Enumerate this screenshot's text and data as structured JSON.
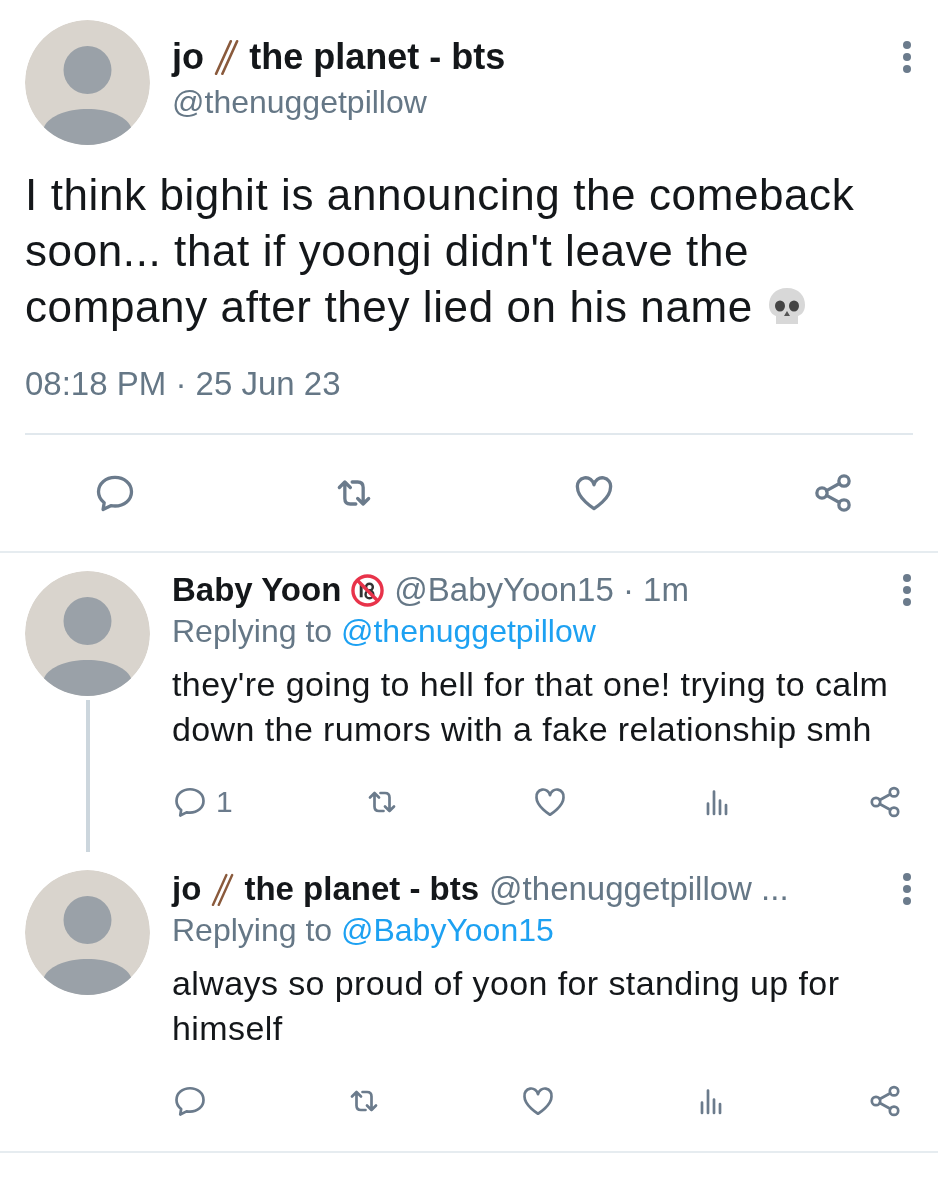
{
  "main_tweet": {
    "name": [
      {
        "kind": "text",
        "text": "jo"
      },
      {
        "kind": "chopsticks"
      },
      {
        "kind": "text",
        "text": "the planet - bts"
      }
    ],
    "handle": "@thenuggetpillow",
    "text": "I think bighit is announcing the comeback soon... that if yoongi didn't leave the company after they lied on his name",
    "trailing_icon": {
      "kind": "skull"
    },
    "timestamp": "08:18 PM · 25 Jun 23",
    "actions": [
      {
        "kind": "reply"
      },
      {
        "kind": "retweet"
      },
      {
        "kind": "like"
      },
      {
        "kind": "share"
      }
    ]
  },
  "replies": [
    {
      "name": [
        {
          "kind": "text",
          "text": "Baby Yoon"
        },
        {
          "kind": "adult"
        }
      ],
      "handle": "@BabyYoon15 · 1m",
      "replying_label": "Replying to",
      "replying_to": "@thenuggetpillow",
      "text": "they're going to hell for that one! trying to calm down the rumors with a fake relationship smh",
      "thread_line": true,
      "actions": [
        {
          "kind": "reply",
          "count": "1"
        },
        {
          "kind": "retweet"
        },
        {
          "kind": "like"
        },
        {
          "kind": "views"
        },
        {
          "kind": "share"
        }
      ]
    },
    {
      "name": [
        {
          "kind": "text",
          "text": "jo"
        },
        {
          "kind": "chopsticks"
        },
        {
          "kind": "text",
          "text": "the planet - bts"
        }
      ],
      "handle": "@thenuggetpillow ...",
      "replying_label": "Replying to",
      "replying_to": "@BabyYoon15",
      "text": "always so proud of yoon for standing up for himself",
      "thread_line": false,
      "actions": [
        {
          "kind": "reply"
        },
        {
          "kind": "retweet"
        },
        {
          "kind": "like"
        },
        {
          "kind": "views"
        },
        {
          "kind": "share"
        }
      ]
    }
  ]
}
